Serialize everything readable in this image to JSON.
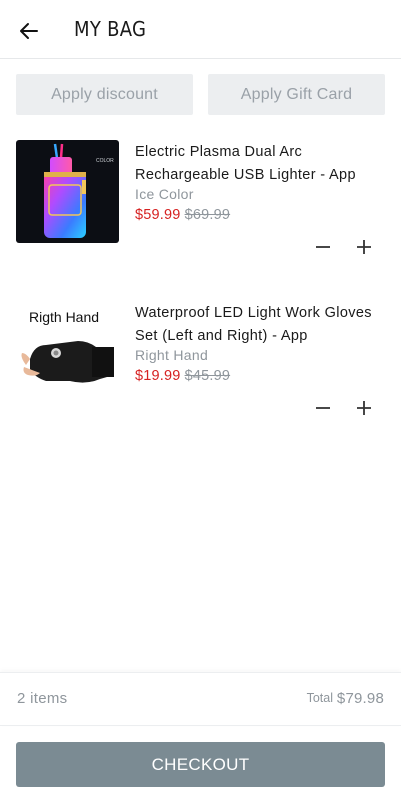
{
  "header": {
    "title": "MY BAG",
    "back_icon": "arrow-left-icon"
  },
  "promos": {
    "discount_label": "Apply discount",
    "gift_label": "Apply Gift Card"
  },
  "items": [
    {
      "name": "Electric Plasma Dual Arc Rechargeable USB Lighter - App",
      "variant": "Ice Color",
      "price": "$59.99",
      "old_price": "$69.99",
      "image_label": "COLOR"
    },
    {
      "name": "Waterproof LED Light Work Gloves Set (Left and Right) - App",
      "variant": "Right Hand",
      "price": "$19.99",
      "old_price": "$45.99",
      "image_label": "Rigth Hand"
    }
  ],
  "summary": {
    "count": "2 items",
    "total_label": "Total",
    "total_value": "$79.98"
  },
  "checkout_label": "CHECKOUT",
  "colors": {
    "sale_price": "#d62222",
    "checkout_bg": "#7b8b93",
    "muted": "#8f969c"
  }
}
